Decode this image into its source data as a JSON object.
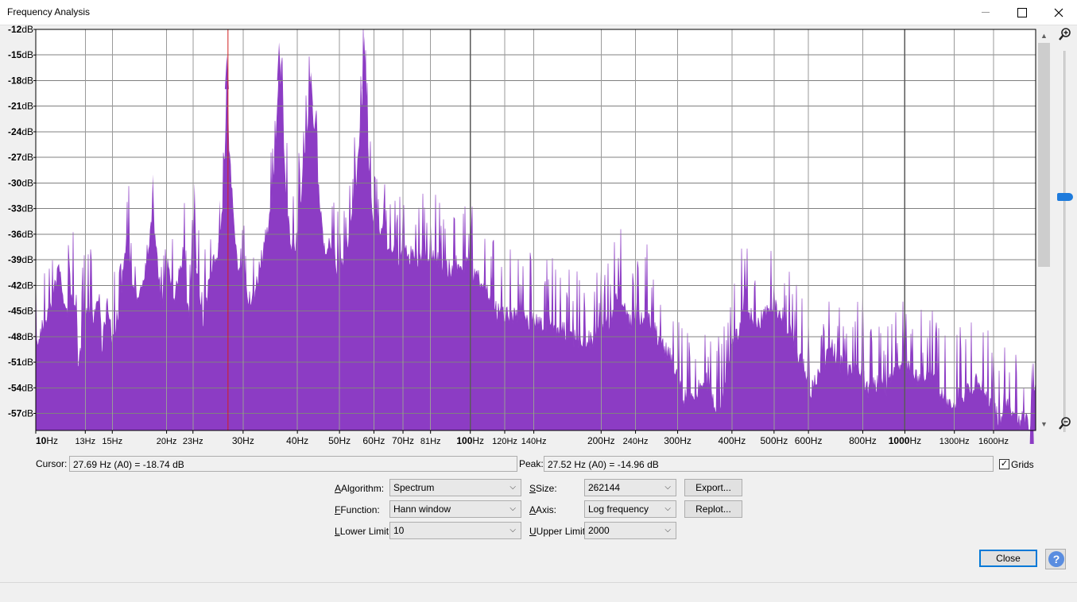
{
  "window": {
    "title": "Frequency Analysis",
    "minimize_icon": "minimize-icon",
    "maximize_icon": "maximize-icon",
    "close_icon": "close-icon"
  },
  "chart_data": {
    "type": "area",
    "title": "",
    "xlabel": "",
    "ylabel": "",
    "x_scale": "log",
    "xlim": [
      10,
      2000
    ],
    "ylim": [
      -59,
      -12
    ],
    "fill_color": "#8c3cc4",
    "grid": true,
    "cursor_x": 27.69,
    "cursor_color": "#d22020",
    "y_ticks": [
      {
        "value": -12,
        "label": "-12dB"
      },
      {
        "value": -15,
        "label": "-15dB"
      },
      {
        "value": -18,
        "label": "-18dB"
      },
      {
        "value": -21,
        "label": "-21dB"
      },
      {
        "value": -24,
        "label": "-24dB"
      },
      {
        "value": -27,
        "label": "-27dB"
      },
      {
        "value": -30,
        "label": "-30dB"
      },
      {
        "value": -33,
        "label": "-33dB"
      },
      {
        "value": -36,
        "label": "-36dB"
      },
      {
        "value": -39,
        "label": "-39dB"
      },
      {
        "value": -42,
        "label": "-42dB"
      },
      {
        "value": -45,
        "label": "-45dB"
      },
      {
        "value": -48,
        "label": "-48dB"
      },
      {
        "value": -51,
        "label": "-51dB"
      },
      {
        "value": -54,
        "label": "-54dB"
      },
      {
        "value": -57,
        "label": "-57dB"
      }
    ],
    "x_ticks": [
      {
        "value": 10,
        "num": "10",
        "unit": "Hz",
        "major": true
      },
      {
        "value": 13,
        "num": "13Hz",
        "unit": "",
        "major": false
      },
      {
        "value": 15,
        "num": "15Hz",
        "unit": "",
        "major": false
      },
      {
        "value": 20,
        "num": "20Hz",
        "unit": "",
        "major": false
      },
      {
        "value": 23,
        "num": "23Hz",
        "unit": "",
        "major": false
      },
      {
        "value": 30,
        "num": "30Hz",
        "unit": "",
        "major": false
      },
      {
        "value": 40,
        "num": "40Hz",
        "unit": "",
        "major": false
      },
      {
        "value": 50,
        "num": "50Hz",
        "unit": "",
        "major": false
      },
      {
        "value": 60,
        "num": "60Hz",
        "unit": "",
        "major": false
      },
      {
        "value": 70,
        "num": "70Hz",
        "unit": "",
        "major": false
      },
      {
        "value": 81,
        "num": "81Hz",
        "unit": "",
        "major": false
      },
      {
        "value": 100,
        "num": "100",
        "unit": "Hz",
        "major": true
      },
      {
        "value": 120,
        "num": "120Hz",
        "unit": "",
        "major": false
      },
      {
        "value": 140,
        "num": "140Hz",
        "unit": "",
        "major": false
      },
      {
        "value": 200,
        "num": "200Hz",
        "unit": "",
        "major": false
      },
      {
        "value": 240,
        "num": "240Hz",
        "unit": "",
        "major": false
      },
      {
        "value": 300,
        "num": "300Hz",
        "unit": "",
        "major": false
      },
      {
        "value": 400,
        "num": "400Hz",
        "unit": "",
        "major": false
      },
      {
        "value": 500,
        "num": "500Hz",
        "unit": "",
        "major": false
      },
      {
        "value": 600,
        "num": "600Hz",
        "unit": "",
        "major": false
      },
      {
        "value": 800,
        "num": "800Hz",
        "unit": "",
        "major": false
      },
      {
        "value": 1000,
        "num": "1000",
        "unit": "Hz",
        "major": true
      },
      {
        "value": 1300,
        "num": "1300Hz",
        "unit": "",
        "major": false
      },
      {
        "value": 1600,
        "num": "1600Hz",
        "unit": "",
        "major": false
      }
    ],
    "envelope": [
      [
        10,
        -48
      ],
      [
        10.5,
        -45
      ],
      [
        11,
        -42
      ],
      [
        11.3,
        -38.5
      ],
      [
        11.7,
        -44
      ],
      [
        12.3,
        -42
      ],
      [
        12.5,
        -51
      ],
      [
        13,
        -44
      ],
      [
        13.5,
        -44.5
      ],
      [
        14,
        -42
      ],
      [
        14.2,
        -48
      ],
      [
        14.6,
        -43
      ],
      [
        15.0,
        -47.5
      ],
      [
        15.5,
        -44
      ],
      [
        16.2,
        -35
      ],
      [
        16.8,
        -42
      ],
      [
        17.5,
        -41
      ],
      [
        18.6,
        -33
      ],
      [
        19.5,
        -43
      ],
      [
        20.2,
        -38
      ],
      [
        20.8,
        -43
      ],
      [
        21.8,
        -37
      ],
      [
        22.5,
        -45
      ],
      [
        23.2,
        -36
      ],
      [
        24.2,
        -46
      ],
      [
        25.5,
        -38
      ],
      [
        26.5,
        -36
      ],
      [
        27.0,
        -30
      ],
      [
        27.3,
        -24
      ],
      [
        27.52,
        -15
      ],
      [
        27.8,
        -24
      ],
      [
        28.3,
        -30
      ],
      [
        29.0,
        -38
      ],
      [
        30,
        -41
      ],
      [
        31.5,
        -43
      ],
      [
        33,
        -38
      ],
      [
        34.5,
        -33
      ],
      [
        35.5,
        -27
      ],
      [
        36.0,
        -19
      ],
      [
        36.3,
        -14
      ],
      [
        36.7,
        -19
      ],
      [
        37.5,
        -29
      ],
      [
        38.5,
        -36
      ],
      [
        39.5,
        -37
      ],
      [
        40.5,
        -32
      ],
      [
        41.5,
        -26
      ],
      [
        42.5,
        -21
      ],
      [
        43.0,
        -17
      ],
      [
        43.5,
        -21
      ],
      [
        44.5,
        -28
      ],
      [
        46,
        -36
      ],
      [
        48,
        -36
      ],
      [
        50,
        -40
      ],
      [
        52,
        -36
      ],
      [
        54,
        -32
      ],
      [
        55.5,
        -25
      ],
      [
        56.5,
        -19
      ],
      [
        57.0,
        -14.96
      ],
      [
        57.5,
        -19
      ],
      [
        58.5,
        -27
      ],
      [
        60,
        -34
      ],
      [
        62,
        -34
      ],
      [
        65,
        -36
      ],
      [
        68,
        -38
      ],
      [
        72,
        -37
      ],
      [
        76,
        -38
      ],
      [
        80,
        -37
      ],
      [
        85,
        -38
      ],
      [
        90,
        -39
      ],
      [
        95,
        -38
      ],
      [
        100,
        -39
      ],
      [
        108,
        -41
      ],
      [
        115,
        -44
      ],
      [
        125,
        -44
      ],
      [
        135,
        -45
      ],
      [
        145,
        -45
      ],
      [
        160,
        -46
      ],
      [
        175,
        -47
      ],
      [
        190,
        -47
      ],
      [
        200,
        -46
      ],
      [
        210,
        -45
      ],
      [
        220,
        -41
      ],
      [
        230,
        -45
      ],
      [
        245,
        -45
      ],
      [
        255,
        -44
      ],
      [
        270,
        -47
      ],
      [
        290,
        -49
      ],
      [
        310,
        -54
      ],
      [
        330,
        -53
      ],
      [
        350,
        -52
      ],
      [
        365,
        -55
      ],
      [
        380,
        -54
      ],
      [
        395,
        -49
      ],
      [
        415,
        -46
      ],
      [
        430,
        -42
      ],
      [
        445,
        -45
      ],
      [
        465,
        -45
      ],
      [
        490,
        -43
      ],
      [
        520,
        -44
      ],
      [
        550,
        -47
      ],
      [
        580,
        -50
      ],
      [
        610,
        -53
      ],
      [
        640,
        -51
      ],
      [
        680,
        -48
      ],
      [
        710,
        -50
      ],
      [
        740,
        -51
      ],
      [
        780,
        -50
      ],
      [
        820,
        -53
      ],
      [
        860,
        -52
      ],
      [
        900,
        -53
      ],
      [
        950,
        -51
      ],
      [
        1000,
        -50
      ],
      [
        1050,
        -51
      ],
      [
        1100,
        -52
      ],
      [
        1150,
        -51
      ],
      [
        1200,
        -53
      ],
      [
        1260,
        -55
      ],
      [
        1320,
        -54
      ],
      [
        1400,
        -53
      ],
      [
        1450,
        -52
      ],
      [
        1520,
        -53
      ],
      [
        1600,
        -55
      ],
      [
        1650,
        -57
      ],
      [
        1700,
        -54
      ],
      [
        1750,
        -56
      ],
      [
        1830,
        -57
      ],
      [
        1900,
        -56
      ],
      [
        1950,
        -58
      ],
      [
        2000,
        -51
      ]
    ],
    "spikes": [
      [
        18.6,
        -29
      ],
      [
        23.2,
        -30
      ],
      [
        26.5,
        -32
      ],
      [
        27.52,
        -15
      ],
      [
        36.3,
        -13.5
      ],
      [
        43.0,
        -17
      ],
      [
        57.0,
        -12.8
      ],
      [
        70,
        -32
      ],
      [
        81,
        -34
      ],
      [
        100,
        -36
      ],
      [
        112,
        -41
      ],
      [
        200,
        -39
      ],
      [
        240,
        -43
      ],
      [
        500,
        -41
      ],
      [
        600,
        -45
      ],
      [
        800,
        -41
      ],
      [
        1000,
        -43
      ],
      [
        1600,
        -48
      ],
      [
        1960,
        -51
      ]
    ]
  },
  "readouts": {
    "cursor_label": "Cursor:",
    "cursor_value": "27.69 Hz (A0) = -18.74 dB",
    "peak_label": "Peak:",
    "peak_value": "27.52 Hz (A0) = -14.96 dB",
    "grids_label": "Grids",
    "grids_checked": true
  },
  "controls": {
    "algorithm_label": "Algorithm:",
    "algorithm_value": "Spectrum",
    "function_label": "Function:",
    "function_value": "Hann window",
    "lower_label": "Lower Limit:",
    "lower_value": "10",
    "size_label": "Size:",
    "size_value": "262144",
    "axis_label": "Axis:",
    "axis_value": "Log frequency",
    "upper_label": "Upper Limit:",
    "upper_value": "2000",
    "export_label": "Export...",
    "replot_label": "Replot...",
    "close_label": "Close",
    "help_glyph": "?"
  },
  "zoom": {
    "zoom_in_icon": "zoom-in-icon",
    "zoom_out_icon": "zoom-out-icon",
    "level": 0.62
  }
}
